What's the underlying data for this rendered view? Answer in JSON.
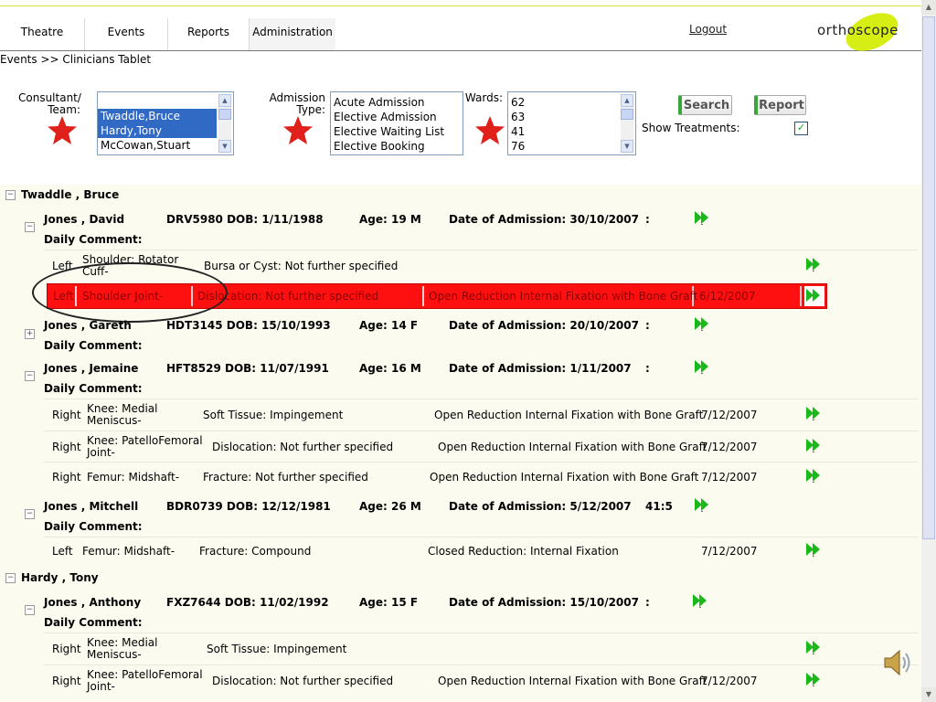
{
  "nav": {
    "tabs": [
      "Theatre",
      "Events",
      "Reports",
      "Administration"
    ],
    "logout": "Logout",
    "logo": "orthoscope"
  },
  "breadcrumb": "Events >> Clinicians Tablet",
  "filters": {
    "consultant_label": "Consultant/\nTeam:",
    "consultants": [
      {
        "name": "",
        "selected": false
      },
      {
        "name": "Twaddle,Bruce",
        "selected": true
      },
      {
        "name": "Hardy,Tony",
        "selected": true
      },
      {
        "name": "McCowan,Stuart",
        "selected": false
      }
    ],
    "admission_label": "Admission\nType:",
    "admission_types": [
      "Acute Admission",
      "Elective Admission",
      "Elective Waiting List",
      "Elective Booking"
    ],
    "wards_label": "Wards:",
    "wards": [
      "62",
      "63",
      "41",
      "76"
    ],
    "search_button": "Search",
    "report_button": "Report",
    "show_treatments_label": "Show Treatments:",
    "show_treatments_checked": "✓"
  },
  "groups": [
    {
      "consultant": "Twaddle , Bruce"
    },
    {
      "consultant": "Hardy , Tony"
    }
  ],
  "patients": [
    {
      "name": "Jones , David",
      "id": "DRV5980 DOB: 1/11/1988",
      "age": "Age: 19 M",
      "admission": "Date of Admission: 30/10/2007",
      "bed": ":",
      "comment": "Daily Comment:"
    },
    {
      "name": "Jones , Gareth",
      "id": "HDT3145 DOB: 15/10/1993",
      "age": "Age: 14 F",
      "admission": "Date of Admission: 20/10/2007",
      "bed": ":",
      "comment": "Daily Comment:"
    },
    {
      "name": "Jones , Jemaine",
      "id": "HFT8529 DOB: 11/07/1991",
      "age": "Age: 16 M",
      "admission": "Date of Admission: 1/11/2007",
      "bed": ":",
      "comment": "Daily Comment:"
    },
    {
      "name": "Jones , Mitchell",
      "id": "BDR0739 DOB: 12/12/1981",
      "age": "Age: 26 M",
      "admission": "Date of Admission: 5/12/2007",
      "bed": "41:5",
      "comment": "Daily Comment:"
    },
    {
      "name": "Jones , Anthony",
      "id": "FXZ7644 DOB: 11/02/1992",
      "age": "Age: 15 F",
      "admission": "Date of Admission: 15/10/2007",
      "bed": ":",
      "comment": "Daily Comment:"
    }
  ],
  "treatments": [
    {
      "side": "Left",
      "site": "Shoulder: Rotator\nCuff-",
      "diagnosis": "Bursa or Cyst: Not further specified",
      "procedure": "",
      "date": ""
    },
    {
      "side": "Left",
      "site": "Shoulder Joint-",
      "diagnosis": "Dislocation: Not further specified",
      "procedure": "Open Reduction Internal Fixation with Bone Graft",
      "date": "6/12/2007"
    },
    {
      "side": "Right",
      "site": "Knee: Medial\nMeniscus-",
      "diagnosis": "Soft Tissue: Impingement",
      "procedure": "Open Reduction Internal Fixation with Bone Graft",
      "date": "7/12/2007"
    },
    {
      "side": "Right",
      "site": "Knee: PatelloFemoral\nJoint-",
      "diagnosis": "Dislocation: Not further specified",
      "procedure": "Open Reduction Internal Fixation with Bone Graft",
      "date": "7/12/2007"
    },
    {
      "side": "Right",
      "site": "Femur: Midshaft-",
      "diagnosis": "Fracture: Not further specified",
      "procedure": "Open Reduction Internal Fixation with Bone Graft",
      "date": "7/12/2007"
    },
    {
      "side": "Left",
      "site": "Femur: Midshaft-",
      "diagnosis": "Fracture: Compound",
      "procedure": "Closed Reduction: Internal Fixation",
      "date": "7/12/2007"
    },
    {
      "side": "Right",
      "site": "Knee: Medial\nMeniscus-",
      "diagnosis": "Soft Tissue: Impingement",
      "procedure": "",
      "date": ""
    },
    {
      "side": "Right",
      "site": "Knee: PatelloFemoral\nJoint-",
      "diagnosis": "Dislocation: Not further specified",
      "procedure": "Open Reduction Internal Fixation with Bone Graft",
      "date": "7/12/2007"
    }
  ],
  "colors": {
    "highlight_row": "#ff1010",
    "accent_green": "#3aa63a",
    "logo_blob": "#d6ee14",
    "star": "#e0201a"
  }
}
